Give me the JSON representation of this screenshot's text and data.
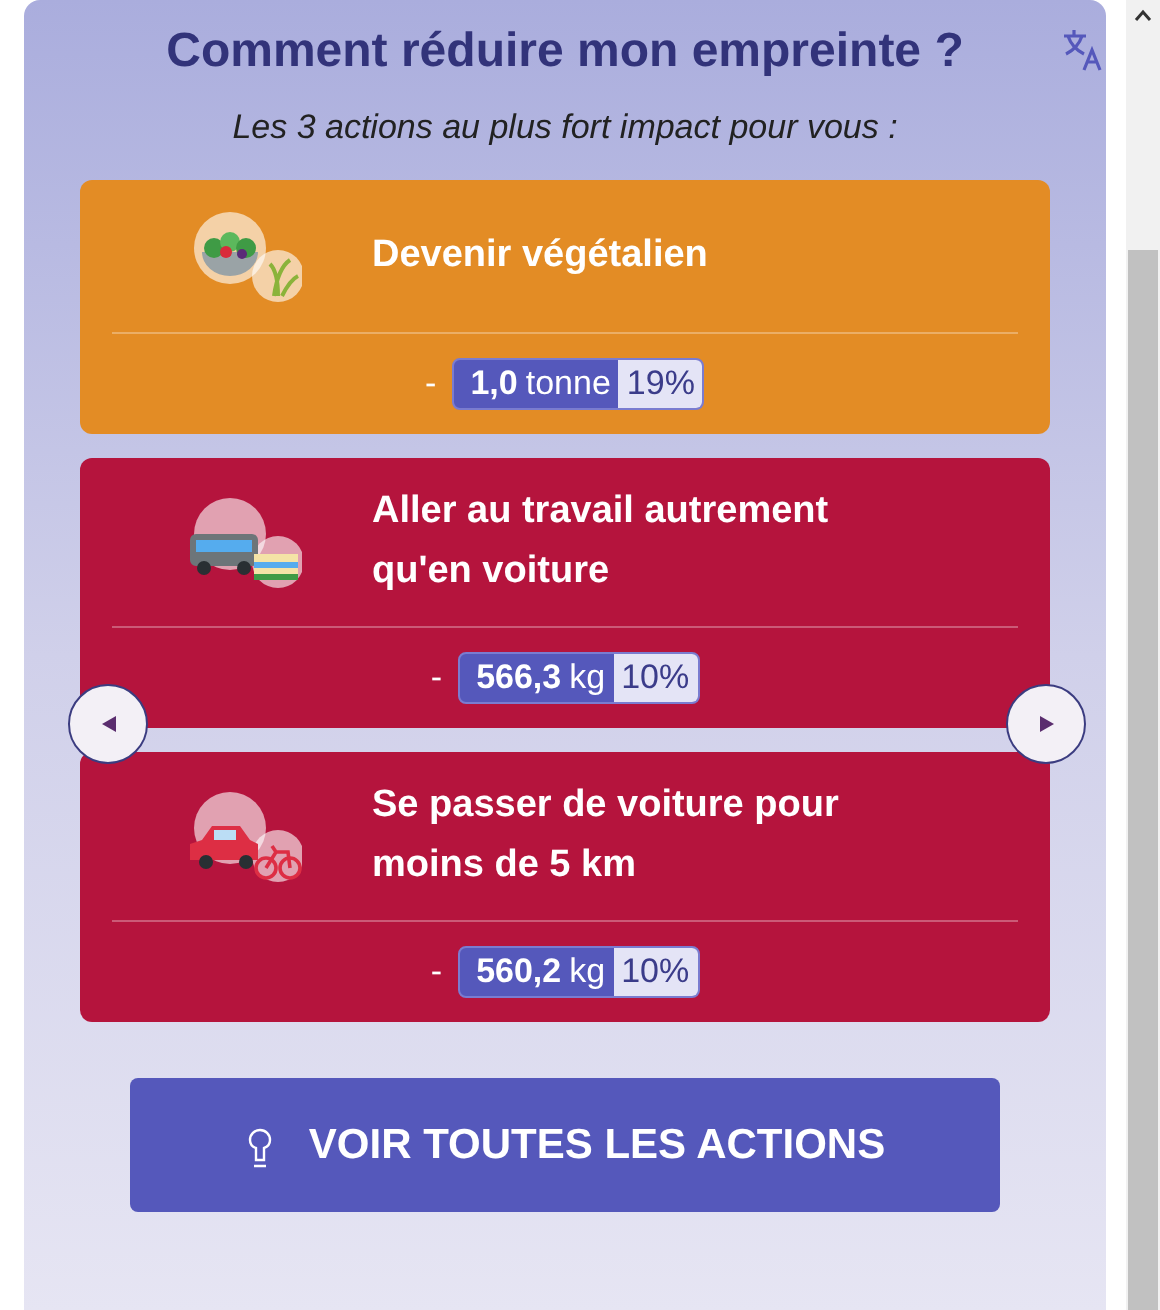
{
  "title": "Comment réduire mon empreinte ?",
  "subtitle": "Les 3 actions au plus fort impact pour vous :",
  "actions": [
    {
      "kind": "salad",
      "color": "#e38c25",
      "title": "Devenir végétalien",
      "sign": "-",
      "amount": "1,0",
      "unit": "tonne",
      "percent": "19%"
    },
    {
      "kind": "bus",
      "color": "#b5143d",
      "title": "Aller au travail autrement qu'en voiture",
      "sign": "-",
      "amount": "566,3",
      "unit": "kg",
      "percent": "10%"
    },
    {
      "kind": "car",
      "color": "#b5143d",
      "title": "Se passer de voiture pour moins de 5 km",
      "sign": "-",
      "amount": "560,2",
      "unit": "kg",
      "percent": "10%"
    }
  ],
  "button": "VOIR TOUTES LES ACTIONS"
}
